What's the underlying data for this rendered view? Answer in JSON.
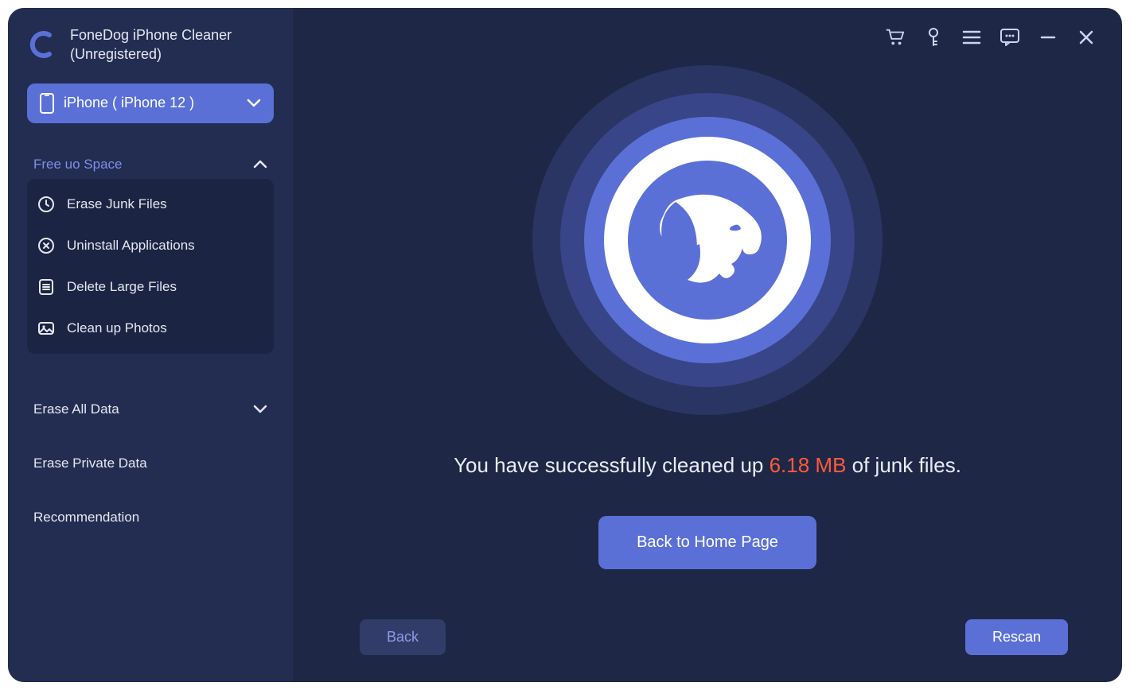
{
  "brand": {
    "title_line1": "FoneDog iPhone  Cleaner",
    "title_line2": "(Unregistered)"
  },
  "device": {
    "label": "iPhone ( iPhone 12 )"
  },
  "sidebar": {
    "free_space": {
      "title": "Free uo Space",
      "items": [
        {
          "label": "Erase Junk Files"
        },
        {
          "label": "Uninstall Applications"
        },
        {
          "label": "Delete Large Files"
        },
        {
          "label": "Clean up Photos"
        }
      ]
    },
    "erase_all": {
      "title": "Erase All Data"
    },
    "erase_private": {
      "title": "Erase Private Data"
    },
    "recommendation": {
      "title": "Recommendation"
    }
  },
  "main": {
    "success_prefix": "You have successfully cleaned up ",
    "success_size": "6.18 MB",
    "success_suffix": " of junk files.",
    "home_button": "Back to Home Page",
    "back_button": "Back",
    "rescan_button": "Rescan"
  }
}
